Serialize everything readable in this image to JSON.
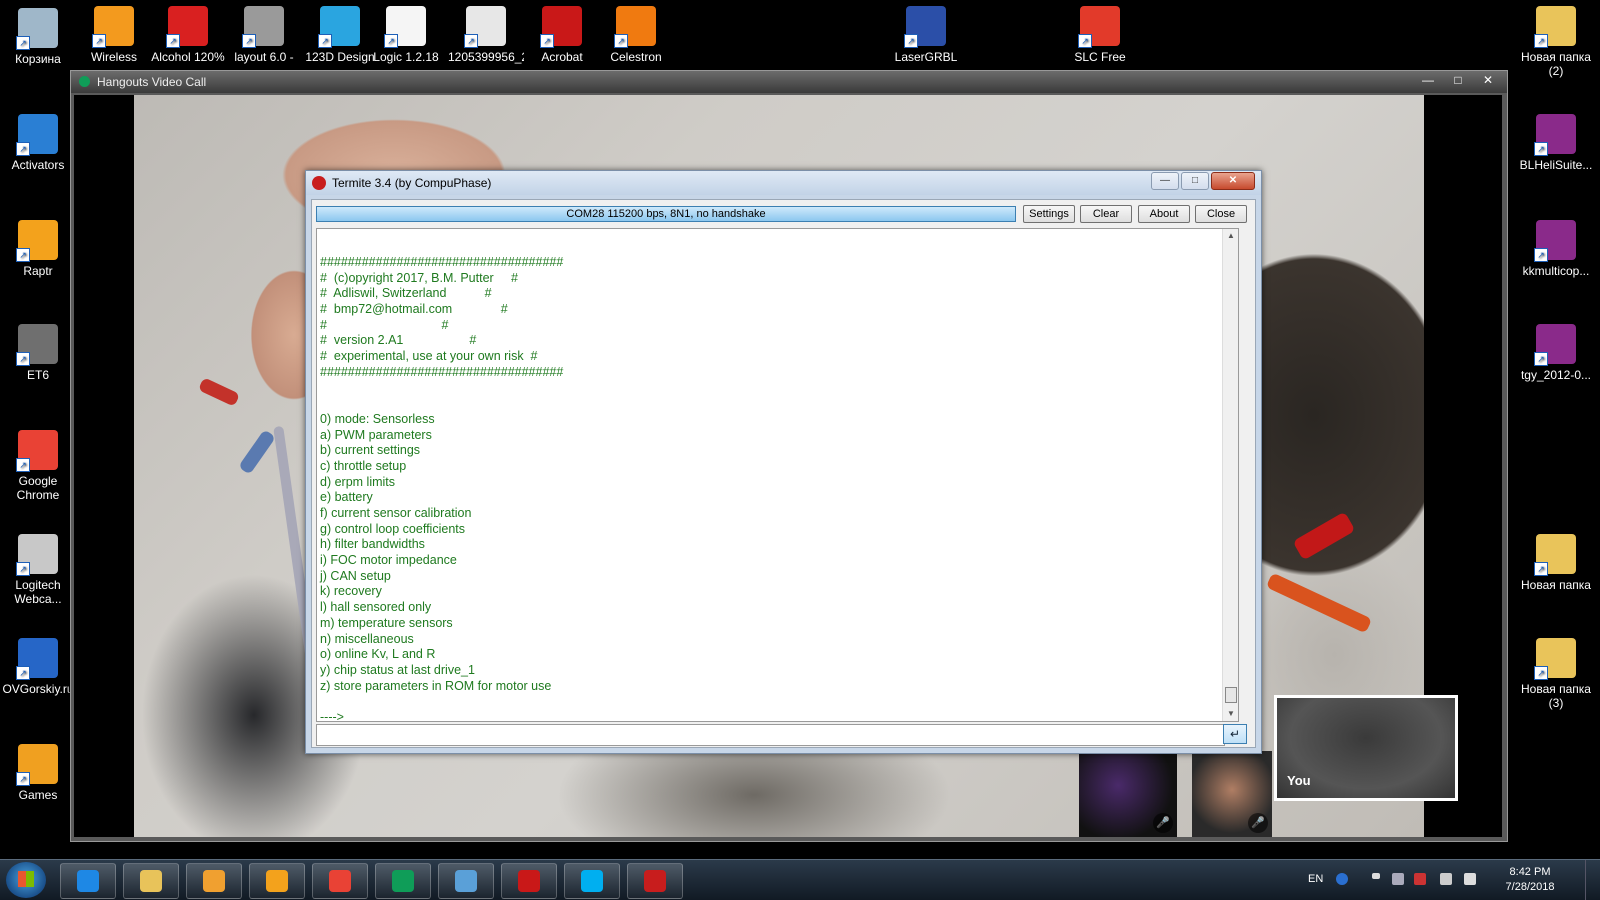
{
  "desktop": {
    "left_icons": [
      {
        "label": "Корзина",
        "color": "#9fb7c9"
      },
      {
        "label": "Activators",
        "color": "#2a7fd4"
      },
      {
        "label": "Raptr",
        "color": "#f3a21c"
      },
      {
        "label": "ET6",
        "color": "#6f6f6f"
      },
      {
        "label": "Google Chrome",
        "color": "#e94235"
      },
      {
        "label": "Logitech Webca...",
        "color": "#c8c8c8"
      },
      {
        "label": "OVGorskiy.ru",
        "color": "#2666c7"
      },
      {
        "label": "Games",
        "color": "#f0a020"
      }
    ],
    "top_icons": [
      {
        "label": "Wireless",
        "color": "#f39a1e"
      },
      {
        "label": "Alcohol 120%",
        "color": "#d92020"
      },
      {
        "label": "layout 6.0 -",
        "color": "#9a9a9a"
      },
      {
        "label": "123D Design",
        "color": "#2aa5e0"
      },
      {
        "label": "Logic 1.2.18",
        "color": "#f5f5f5"
      },
      {
        "label": "1205399956_2...",
        "color": "#e7e7e7"
      },
      {
        "label": "Acrobat",
        "color": "#c91818"
      },
      {
        "label": "Celestron",
        "color": "#f07a10"
      },
      {
        "label": "LaserGRBL",
        "color": "#2b4fa8"
      },
      {
        "label": "SLC Free",
        "color": "#e23a2a"
      }
    ],
    "right_icons": [
      {
        "label": "Новая папка (2)",
        "color": "#e9c45a"
      },
      {
        "label": "BLHeliSuite...",
        "color": "#8a2a8a"
      },
      {
        "label": "kkmulticop...",
        "color": "#8a2a8a"
      },
      {
        "label": "tgy_2012-0...",
        "color": "#8a2a8a"
      },
      {
        "label": "Новая папка",
        "color": "#e9c45a"
      },
      {
        "label": "Новая папка (3)",
        "color": "#e9c45a"
      }
    ]
  },
  "hangouts": {
    "title": "Hangouts Video Call",
    "you_label": "You",
    "accent": "#0f9d58"
  },
  "termite": {
    "title": "Termite 3.4 (by CompuPhase)",
    "status": "COM28 115200 bps, 8N1, no handshake",
    "buttons": {
      "settings": "Settings",
      "clear": "Clear",
      "about": "About",
      "close": "Close"
    },
    "console_lines": [
      "###################################",
      "#  (c)opyright 2017, B.M. Putter     #",
      "#  Adliswil, Switzerland           #",
      "#  bmp72@hotmail.com              #",
      "#                                 #",
      "#  version 2.A1                   #",
      "#  experimental, use at your own risk  #",
      "###################################",
      "",
      "",
      "0) mode: Sensorless",
      "a) PWM parameters",
      "b) current settings",
      "c) throttle setup",
      "d) erpm limits",
      "e) battery",
      "f) current sensor calibration",
      "g) control loop coefficients",
      "h) filter bandwidths",
      "i) FOC motor impedance",
      "j) CAN setup",
      "k) recovery",
      "l) hall sensored only",
      "m) temperature sensors",
      "n) miscellaneous",
      "o) online Kv, L and R",
      "y) chip status at last drive_1",
      "z) store parameters in ROM for motor use",
      "",
      "---->"
    ],
    "input_value": "",
    "send_glyph": "↵",
    "text_color": "#1f7a1f"
  },
  "taskbar": {
    "apps": [
      {
        "name": "ie",
        "color": "#1e88e5"
      },
      {
        "name": "explorer",
        "color": "#e8c35a"
      },
      {
        "name": "media",
        "color": "#f0a030"
      },
      {
        "name": "raptr",
        "color": "#f3a21c"
      },
      {
        "name": "chrome",
        "color": "#e94235"
      },
      {
        "name": "hangouts",
        "color": "#0f9d58"
      },
      {
        "name": "remote",
        "color": "#5aa0d8"
      },
      {
        "name": "acrobat",
        "color": "#c91818"
      },
      {
        "name": "skype",
        "color": "#00aff0"
      },
      {
        "name": "termite",
        "color": "#c81d1d"
      }
    ],
    "language": "EN",
    "time": "8:42 PM",
    "date": "7/28/2018"
  }
}
